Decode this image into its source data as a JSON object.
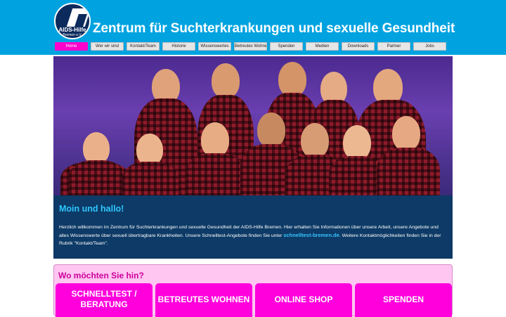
{
  "header": {
    "logo_text": "AIDS-Hilfe",
    "logo_subtext": "Bremen e.V.",
    "title": "Zentrum für Suchterkrankungen und sexuelle Gesundheit"
  },
  "nav": {
    "items": [
      {
        "label": "Home"
      },
      {
        "label": "Wer wir sind"
      },
      {
        "label": "Kontakt/Team"
      },
      {
        "label": "Historie"
      },
      {
        "label": "Wissenswertes"
      },
      {
        "label": "Betreutes Wohnen"
      },
      {
        "label": "Spenden"
      },
      {
        "label": "Medien"
      },
      {
        "label": "Downloads"
      },
      {
        "label": "Partner"
      },
      {
        "label": "Jobs"
      }
    ]
  },
  "welcome": {
    "heading": "Moin und hallo!",
    "text_before_link": "Herzlich willkommen im Zentrum für Suchterkrankungen und sexuelle Gesundheit der AIDS-Hilfe Bremen. Hier erhalten Sie Informationen über unsere Arbeit, unsere Angebote und alles Wissenswerte über sexuell übertragbare Krankheiten. Unsere Schnelltest-Angebote finden Sie unter ",
    "link_text": "schnelltest-bremen.de",
    "text_after_link": ". Weitere Kontaktmöglichkeiten finden Sie in der Rubrik \"Kontakt/Team\"."
  },
  "destinations": {
    "heading": "Wo möchten Sie hin?",
    "buttons": [
      {
        "label": "SCHNELLTEST / BERATUNG"
      },
      {
        "label": "BETREUTES WOHNEN"
      },
      {
        "label": "ONLINE SHOP"
      },
      {
        "label": "SPENDEN"
      }
    ]
  },
  "colors": {
    "header_bg": "#00a3e0",
    "nav_active": "#ff00cc",
    "welcome_bg": "#0d3a66",
    "welcome_heading": "#2ec6ff",
    "dest_bg": "#ffc6f2",
    "dest_button": "#ff00dd"
  }
}
